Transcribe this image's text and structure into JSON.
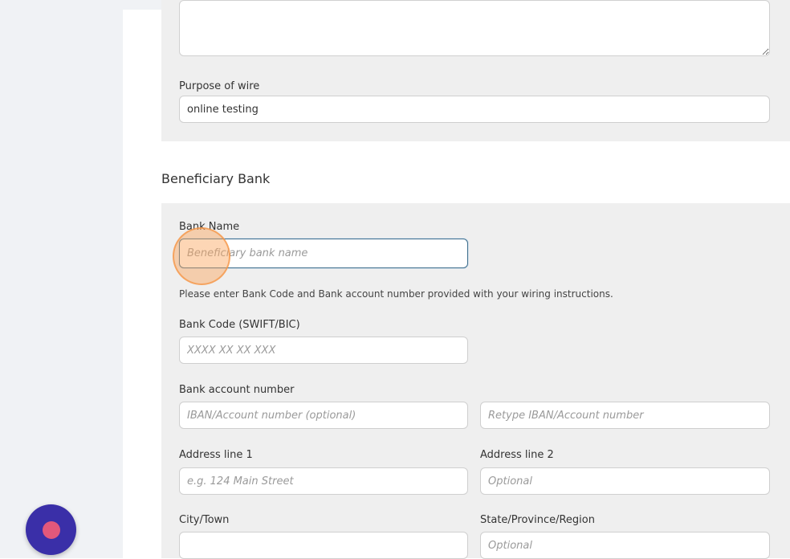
{
  "wire": {
    "notes_value": "",
    "purpose_label": "Purpose of wire",
    "purpose_value": "online testing"
  },
  "beneficiary_bank": {
    "section_title": "Beneficiary Bank",
    "bank_name_label": "Bank Name",
    "bank_name_placeholder": "Beneficiary bank name",
    "hint": "Please enter Bank Code and Bank account number provided with your wiring instructions.",
    "bank_code_label": "Bank Code (SWIFT/BIC)",
    "bank_code_placeholder": "XXXX XX XX XXX",
    "account_label": "Bank account number",
    "account_placeholder": "IBAN/Account number (optional)",
    "account_retype_placeholder": "Retype IBAN/Account number",
    "address1_label": "Address line 1",
    "address1_placeholder": "e.g. 124 Main Street",
    "address2_label": "Address line 2",
    "address2_placeholder": "Optional",
    "city_label": "City/Town",
    "city_value": "",
    "state_label": "State/Province/Region",
    "state_placeholder": "Optional"
  },
  "colors": {
    "page_bg": "#f0f2f5",
    "panel_bg": "#efefef",
    "focus_border": "#3d6d8c",
    "fab_bg": "#3a2fa8",
    "fab_dot": "#e2587b",
    "click_marker": "#f5a05a"
  },
  "icons": {
    "resize_handle": "resize-handle-icon",
    "fab": "record-dot-icon"
  }
}
